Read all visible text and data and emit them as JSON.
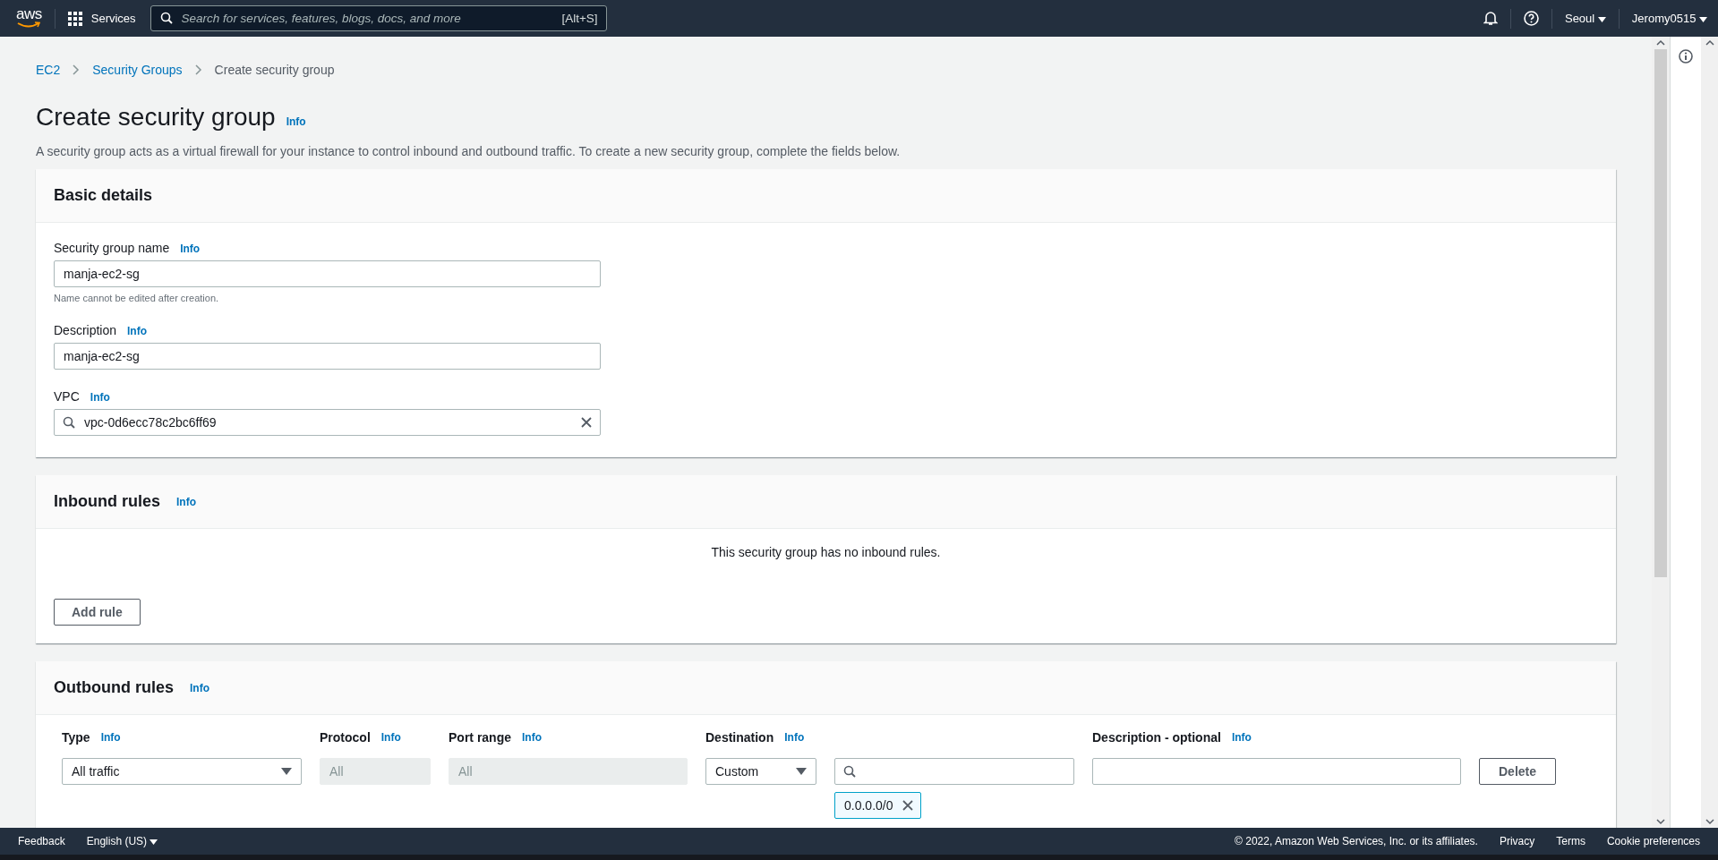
{
  "top_nav": {
    "logo": "aws",
    "services": "Services",
    "search": {
      "placeholder": "Search for services, features, blogs, docs, and more",
      "shortcut": "[Alt+S]"
    },
    "region": "Seoul",
    "account": "Jeromy0515"
  },
  "breadcrumbs": [
    {
      "label": "EC2",
      "link": true
    },
    {
      "label": "Security Groups",
      "link": true
    },
    {
      "label": "Create security group",
      "link": false
    }
  ],
  "page": {
    "title": "Create security group",
    "info": "Info",
    "description": "A security group acts as a virtual firewall for your instance to control inbound and outbound traffic. To create a new security group, complete the fields below."
  },
  "basic_details": {
    "title": "Basic details",
    "fields": [
      {
        "kind": "text",
        "label": "Security group name",
        "info": "Info",
        "value": "manja-ec2-sg",
        "hint": "Name cannot be edited after creation."
      },
      {
        "kind": "text",
        "label": "Description",
        "info": "Info",
        "value": "manja-ec2-sg"
      },
      {
        "kind": "search",
        "label": "VPC",
        "info": "Info",
        "value": "vpc-0d6ecc78c2bc6ff69"
      }
    ]
  },
  "inbound_rules": {
    "title": "Inbound rules",
    "info": "Info",
    "empty_message": "This security group has no inbound rules.",
    "add_button": "Add rule"
  },
  "outbound_rules": {
    "title": "Outbound rules",
    "info": "Info",
    "columns": [
      {
        "label": "Type",
        "info": "Info"
      },
      {
        "label": "Protocol",
        "info": "Info"
      },
      {
        "label": "Port range",
        "info": "Info"
      },
      {
        "label": "Destination",
        "info": "Info"
      },
      {
        "label": "Description - optional",
        "info": "Info"
      }
    ],
    "rows": [
      {
        "type": "All traffic",
        "protocol": {
          "value": "All",
          "disabled": true
        },
        "port_range": {
          "value": "All",
          "disabled": true
        },
        "destination": "Custom",
        "tokens": [
          "0.0.0.0/0"
        ],
        "delete": "Delete"
      }
    ]
  },
  "footer": {
    "feedback": "Feedback",
    "language": "English (US)",
    "copyright": "© 2022, Amazon Web Services, Inc. or its affiliates.",
    "links": [
      "Privacy",
      "Terms",
      "Cookie preferences"
    ]
  }
}
